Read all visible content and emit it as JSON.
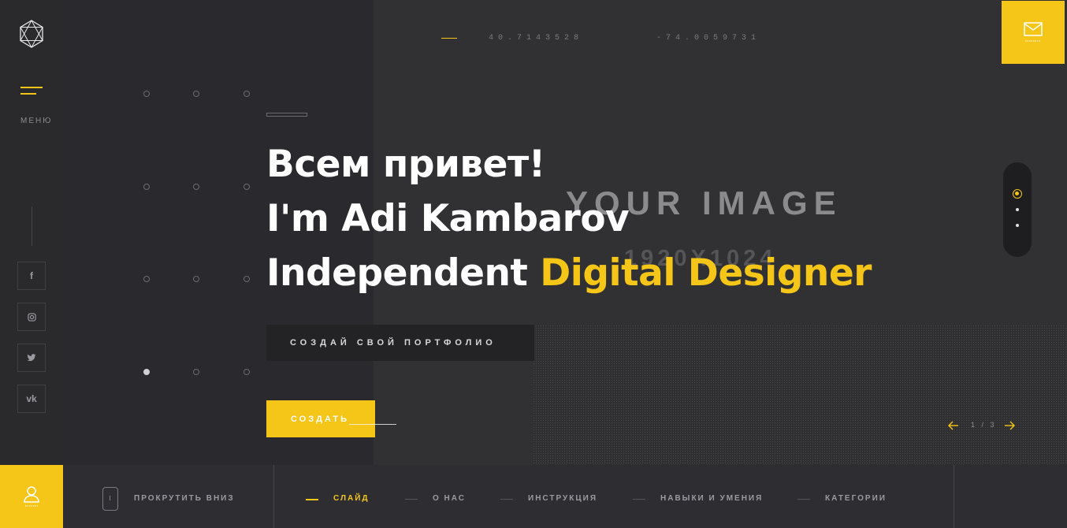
{
  "sidebar": {
    "menu_label": "МЕНЮ",
    "social": [
      {
        "name": "facebook-icon",
        "glyph": "f"
      },
      {
        "name": "instagram-icon",
        "glyph": "◎"
      },
      {
        "name": "twitter-icon",
        "glyph": "🕊"
      },
      {
        "name": "vk-icon",
        "glyph": "vk"
      }
    ]
  },
  "coordinates": {
    "lat": "40.7143528",
    "lng": "-74.0059731"
  },
  "image_placeholder": {
    "line1": "YOUR IMAGE",
    "line2": "1920X1024"
  },
  "hero": {
    "line1": "Всем привет!",
    "line2": "I'm Adi Kambarov",
    "line3_prefix": "Independent ",
    "line3_accent": "Digital Designer"
  },
  "cta": {
    "dark_label": "СОЗДАЙ СВОЙ ПОРТФОЛИО",
    "yellow_label": "СОЗДАТЬ"
  },
  "slider": {
    "current": "1",
    "total": "3",
    "counter": "1 / 3"
  },
  "bottom": {
    "scroll_label": "ПРОКРУТИТЬ ВНИЗ",
    "nav": [
      {
        "label": "СЛАЙД",
        "active": true
      },
      {
        "label": "О НАС",
        "active": false
      },
      {
        "label": "ИНСТРУКЦИЯ",
        "active": false
      },
      {
        "label": "НАВЫКИ И УМЕНИЯ",
        "active": false
      },
      {
        "label": "КАТЕГОРИИ",
        "active": false
      }
    ]
  },
  "colors": {
    "accent": "#f5c518",
    "background": "#2b2b2e"
  }
}
